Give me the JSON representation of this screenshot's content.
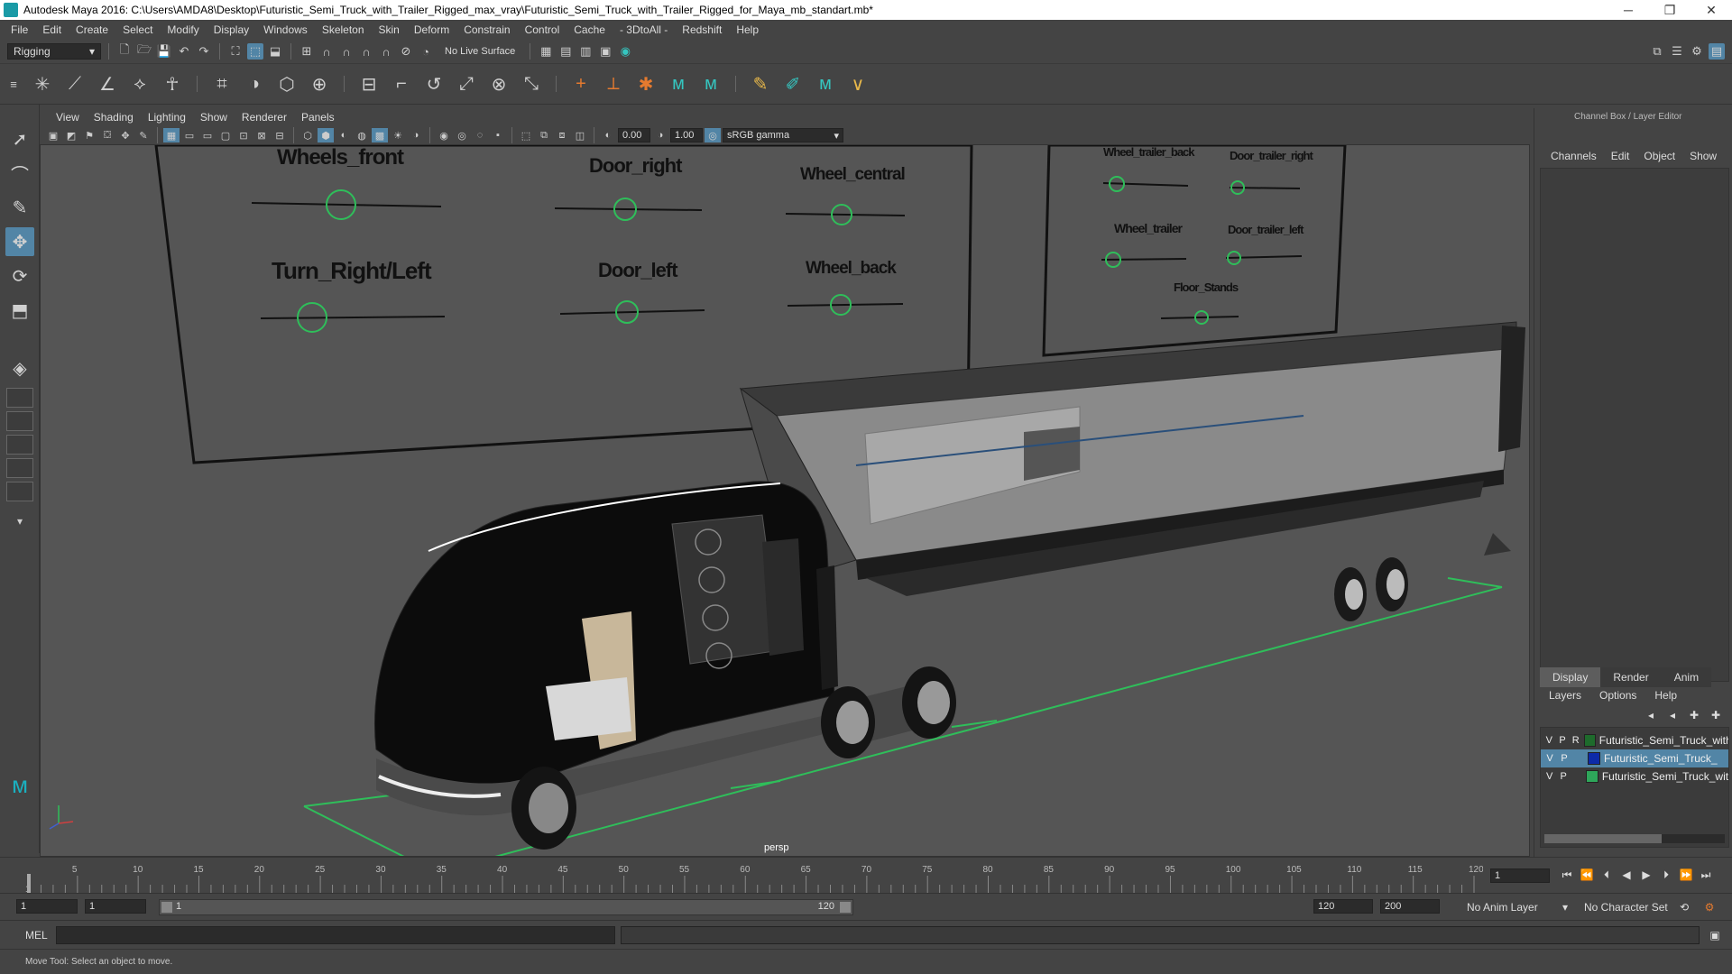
{
  "window": {
    "title": "Autodesk Maya 2016: C:\\Users\\AMDA8\\Desktop\\Futuristic_Semi_Truck_with_Trailer_Rigged_max_vray\\Futuristic_Semi_Truck_with_Trailer_Rigged_for_Maya_mb_standart.mb*",
    "minimize": "─",
    "restore": "❐",
    "close": "✕"
  },
  "menubar": [
    "File",
    "Edit",
    "Create",
    "Select",
    "Modify",
    "Display",
    "Windows",
    "Skeleton",
    "Skin",
    "Deform",
    "Constrain",
    "Control",
    "Cache",
    "- 3DtoAll -",
    "Redshift",
    "Help"
  ],
  "statusline": {
    "menuset": "Rigging",
    "live_surface": "No Live Surface"
  },
  "panel": {
    "menus": [
      "View",
      "Shading",
      "Lighting",
      "Show",
      "Renderer",
      "Panels"
    ],
    "exposure": "0.00",
    "gamma": "1.00",
    "color_space": "sRGB gamma",
    "camera": "persp"
  },
  "controls_board_1": {
    "labels": [
      "Wheels_front",
      "Door_right",
      "Wheel_central",
      "Turn_Right/Left",
      "Door_left",
      "Wheel_back"
    ]
  },
  "controls_board_2": {
    "labels": [
      "Wheel_trailer_back",
      "Door_trailer_right",
      "Wheel_trailer",
      "Door_trailer_left",
      "Floor_Stands"
    ]
  },
  "channelbox": {
    "title": "Channel Box / Layer Editor",
    "menus": [
      "Channels",
      "Edit",
      "Object",
      "Show"
    ]
  },
  "layer_editor": {
    "tabs": [
      "Display",
      "Render",
      "Anim"
    ],
    "menus": [
      "Layers",
      "Options",
      "Help"
    ],
    "layers": [
      {
        "v": "V",
        "p": "P",
        "r": "R",
        "name": "Futuristic_Semi_Truck_with_T",
        "color": "#1e6b2c"
      },
      {
        "v": "V",
        "p": "P",
        "r": "",
        "name": "Futuristic_Semi_Truck_",
        "color": "#0d2aa8"
      },
      {
        "v": "V",
        "p": "P",
        "r": "",
        "name": "Futuristic_Semi_Truck_with",
        "color": "#2ea65a"
      }
    ]
  },
  "timeline": {
    "ticks": [
      "1",
      "5",
      "10",
      "15",
      "20",
      "25",
      "30",
      "35",
      "40",
      "45",
      "50",
      "55",
      "60",
      "65",
      "70",
      "75",
      "80",
      "85",
      "90",
      "95",
      "100",
      "105",
      "110",
      "115",
      "120"
    ],
    "current_frame": "1",
    "range_start": "1",
    "range_start_inner": "1",
    "range_slider_start": "1",
    "range_slider_end": "120",
    "range_end_inner": "120",
    "range_end": "200",
    "anim_layer": "No Anim Layer",
    "character_set": "No Character Set"
  },
  "cmdline": {
    "label": "MEL"
  },
  "helpline": {
    "text": "Move Tool: Select an object to move."
  },
  "colors": {
    "accent": "#5285a6",
    "viewport_bg": "#555555",
    "ground_grid": "#2fbe5a",
    "control_ring": "#2fbe5a"
  }
}
